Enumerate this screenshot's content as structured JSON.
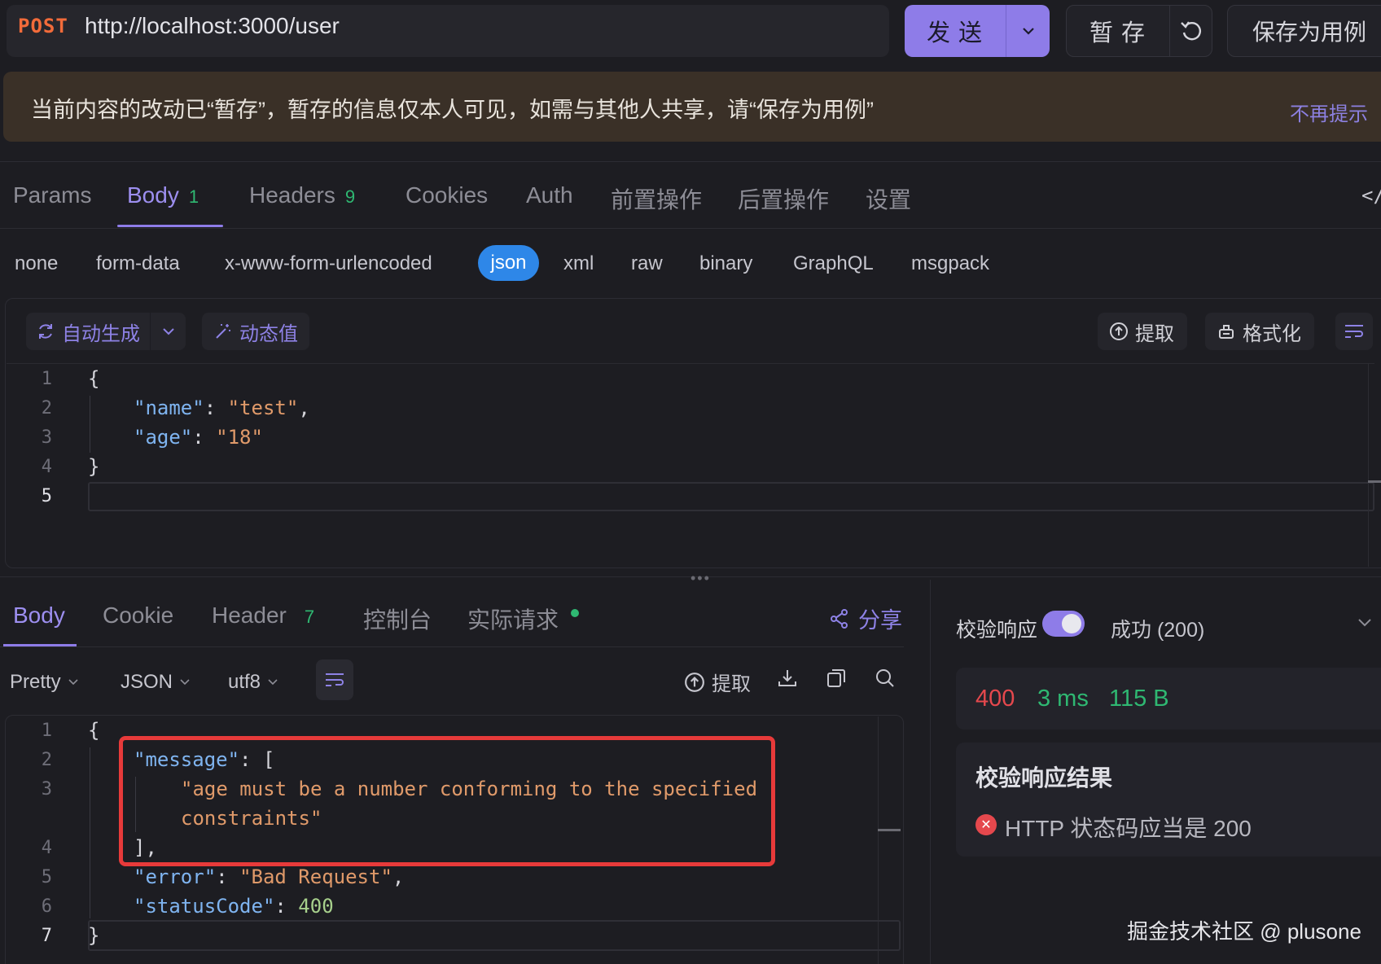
{
  "request": {
    "method": "POST",
    "url": "http://localhost:3000/user",
    "send_label": "发送",
    "draft_label": "暂存",
    "save_as_label": "保存为用例"
  },
  "banner": {
    "text": "当前内容的改动已“暂存”，暂存的信息仅本人可见，如需与其他人共享，请“保存为用例”",
    "dismiss": "不再提示"
  },
  "request_tabs": [
    {
      "label": "Params",
      "count": ""
    },
    {
      "label": "Body",
      "count": "1"
    },
    {
      "label": "Headers",
      "count": "9"
    },
    {
      "label": "Cookies",
      "count": ""
    },
    {
      "label": "Auth",
      "count": ""
    },
    {
      "label": "前置操作",
      "count": ""
    },
    {
      "label": "后置操作",
      "count": ""
    },
    {
      "label": "设置",
      "count": ""
    }
  ],
  "body_types": [
    "none",
    "form-data",
    "x-www-form-urlencoded",
    "json",
    "xml",
    "raw",
    "binary",
    "GraphQL",
    "msgpack"
  ],
  "editor_toolbar": {
    "auto_generate": "自动生成",
    "dynamic_value": "动态值",
    "extract": "提取",
    "format": "格式化"
  },
  "request_body_lines": {
    "l1": "{",
    "l2_key": "\"name\"",
    "l2_val": "\"test\"",
    "l3_key": "\"age\"",
    "l3_val": "\"18\"",
    "l4": "}"
  },
  "response_tabs": [
    {
      "label": "Body",
      "count": ""
    },
    {
      "label": "Cookie",
      "count": ""
    },
    {
      "label": "Header",
      "count": "7"
    },
    {
      "label": "控制台",
      "count": ""
    },
    {
      "label": "实际请求",
      "count": ""
    }
  ],
  "share_label": "分享",
  "response_options": {
    "view": "Pretty",
    "format": "JSON",
    "encoding": "utf8",
    "extract": "提取"
  },
  "response_body": {
    "message_key": "\"message\"",
    "message_line1": "\"age must be a number conforming to the specified",
    "message_line2": "constraints\"",
    "error_key": "\"error\"",
    "error_val": "\"Bad Request\"",
    "status_key": "\"statusCode\"",
    "status_val": "400"
  },
  "validation": {
    "label": "校验响应",
    "enabled": true,
    "expected": "成功 (200)",
    "status_code": "400",
    "time": "3 ms",
    "size": "115 B",
    "result_title": "校验响应结果",
    "result_text": "HTTP 状态码应当是 200"
  },
  "watermark": "掘金技术社区 @ plusone",
  "colors": {
    "accent": "#8e7ce8",
    "method": "#f26b3a",
    "count_green": "#2fb872",
    "error_red": "#e5484d",
    "highlight_box": "#e73a3a",
    "json_pill": "#2e87e8"
  }
}
